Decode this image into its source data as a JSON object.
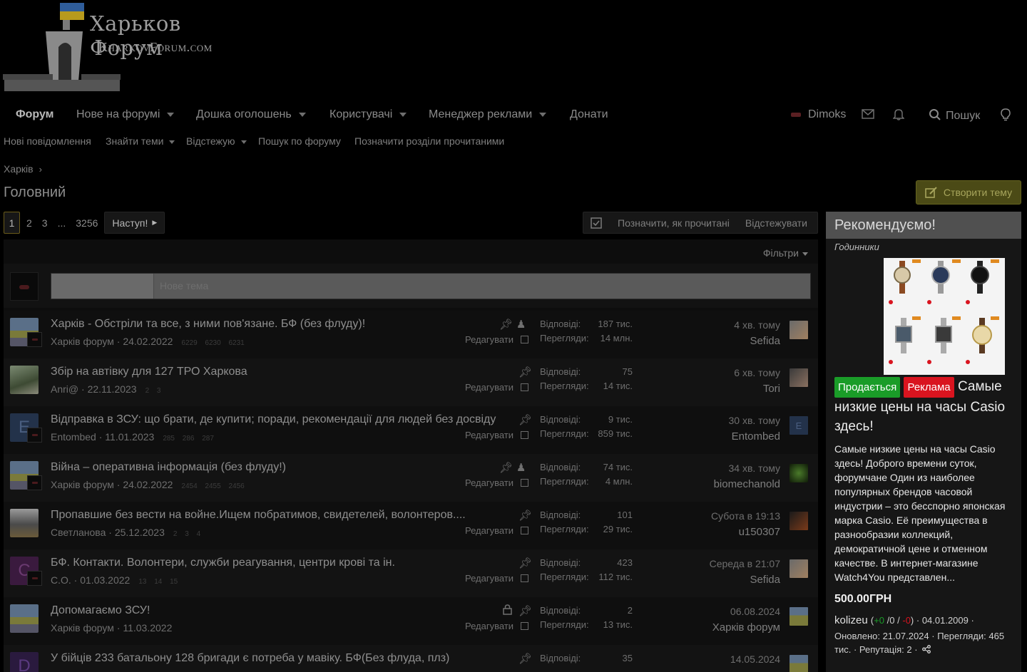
{
  "logo": {
    "title": "Харьков Форум",
    "subtitle": "KharkovForum.com"
  },
  "nav": {
    "items": [
      {
        "label": "Форум"
      },
      {
        "label": "Нове на форумі"
      },
      {
        "label": "Дошка оголошень"
      },
      {
        "label": "Користувачі"
      },
      {
        "label": "Менеджер реклами"
      },
      {
        "label": "Донати"
      }
    ],
    "user": "Dimoks",
    "search": "Пошук"
  },
  "subnav": [
    "Нові повідомлення",
    "Знайти теми",
    "Відстежую",
    "Пошук по форуму",
    "Позначити розділи прочитаними"
  ],
  "breadcrumb": "Харків",
  "page_title": "Головний",
  "create_thread": "Створити тему",
  "pagination": {
    "pages": [
      "1",
      "2",
      "3",
      "...",
      "3256"
    ],
    "next": "Наступ!"
  },
  "mark_read": "Позначити, як прочитані",
  "watch": "Відстежувати",
  "filters": "Фільтри",
  "new_thread_placeholder": "Нове тема",
  "labels": {
    "replies": "Відповіді:",
    "views": "Перегляди:",
    "edit": "Редагувати"
  },
  "threads": [
    {
      "title": "Харків - Обстріли та все, з ними пов'язане. БФ (без флуду)!",
      "author": "Харків форум",
      "date": "24.02.2022",
      "pages": "6229 6230 6231",
      "replies": "187 тис.",
      "views": "14 млн.",
      "last_time": "4 хв. тому",
      "last_user": "Sefida"
    },
    {
      "title": "Збір на автівку для 127 ТРО Харкова",
      "author": "Anri@",
      "date": "22.11.2023",
      "pages": "2 3",
      "replies": "75",
      "views": "14 тис.",
      "last_time": "6 хв. тому",
      "last_user": "Tori"
    },
    {
      "title": "Відправка в ЗСУ: що брати, де купити; поради, рекомендації для людей без досвіду",
      "author": "Entombed",
      "date": "11.01.2023",
      "pages": "285 286 287",
      "replies": "9 тис.",
      "views": "859 тис.",
      "last_time": "30 хв. тому",
      "last_user": "Entombed"
    },
    {
      "title": "Війна – оперативна інформація (без флуду!)",
      "author": "Харків форум",
      "date": "24.02.2022",
      "pages": "2454 2455 2456",
      "replies": "74 тис.",
      "views": "4 млн.",
      "last_time": "34 хв. тому",
      "last_user": "biomechanold"
    },
    {
      "title": "Пропавшие без вести на войне.Ищем побратимов, свидетелей, волонтеров....",
      "author": "Светланова",
      "date": "25.12.2023",
      "pages": "2 3 4",
      "replies": "101",
      "views": "29 тис.",
      "last_time": "Субота в 19:13",
      "last_user": "u150307"
    },
    {
      "title": "БФ. Контакти. Волонтери, служби реагування, центри крові та ін.",
      "author": "C.O.",
      "date": "01.03.2022",
      "pages": "13 14 15",
      "replies": "423",
      "views": "112 тис.",
      "last_time": "Середа в 21:07",
      "last_user": "Sefida"
    },
    {
      "title": "Допомагаємо ЗСУ!",
      "author": "Харків форум",
      "date": "11.03.2022",
      "pages": "",
      "replies": "2",
      "views": "13 тис.",
      "last_time": "06.08.2024",
      "last_user": "Харків форум"
    },
    {
      "title": "У бійців 233 батальону 128 бригади є потреба у мавіку. БФ(Без флуда, плз)",
      "author": "D",
      "date": "",
      "pages": "",
      "replies": "35",
      "views": "",
      "last_time": "14.05.2024",
      "last_user": ""
    }
  ],
  "sidebar": {
    "header": "Рекомендуємо!",
    "category": "Годинники",
    "tag_sale": "Продається",
    "tag_ad": "Реклама",
    "headline": "Самые низкие цены на часы Casio здесь!",
    "description": "Самые низкие цены на часы Casio здесь! Доброго времени суток, форумчане Один из наиболее популярных брендов часовой индустрии – это бесспорно японская марка Casio. Её преимущества в разнообразии коллекций, демократичной цене и отменном качестве. В интернет-магазине Watch4You представлен...",
    "price": "500.00ГРН",
    "user": "kolizeu",
    "rating_pos": "+0",
    "rating_neu": "0",
    "rating_neg": "-0",
    "joined": "04.01.2009",
    "updated": "Оновлено: 21.07.2024 · Перегляди: 465 тис. · Репутація: 2 ·"
  },
  "colors": {
    "accent": "#6a5b1a",
    "button": "#4b4a16",
    "sale": "#1a9c28",
    "ad": "#d9141f"
  }
}
